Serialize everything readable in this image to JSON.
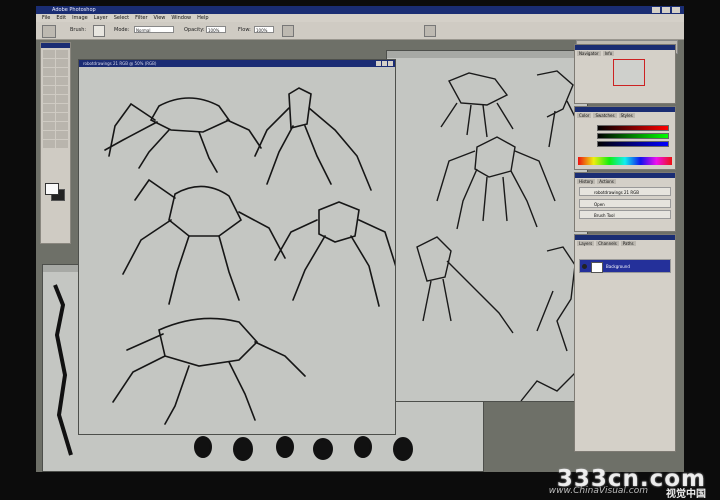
{
  "app": {
    "title": "Adobe Photoshop",
    "menu": [
      "File",
      "Edit",
      "Image",
      "Layer",
      "Select",
      "Filter",
      "View",
      "Window",
      "Help"
    ]
  },
  "options_bar": {
    "brush_label": "Brush:",
    "mode_label": "Mode:",
    "mode_value": "Normal",
    "opacity_label": "Opacity:",
    "opacity_value": "100%",
    "flow_label": "Flow:",
    "flow_value": "100%"
  },
  "documents": {
    "active_title": "robotdrawings 21 RGB @ 50% (RGB)",
    "back_title_1": "",
    "back_title_2": ""
  },
  "palettes": {
    "navigator_tabs": [
      "Navigator",
      "Info"
    ],
    "color_tabs": [
      "Color",
      "Swatches",
      "Styles"
    ],
    "history_tabs": [
      "History",
      "Actions"
    ],
    "history_items": [
      "robotdrawings 21 RGB",
      "Open",
      "Brush Tool"
    ],
    "layers_tabs": [
      "Layers",
      "Channels",
      "Paths"
    ],
    "layer_name": "Background"
  },
  "overlay": {
    "watermark": "333cn.com",
    "site": "www.ChinaVisual.com",
    "brand": "视觉中国"
  },
  "colors": {
    "title_bar": "#1a2d73",
    "workspace": "#6e7068",
    "canvas": "#c4c6c2",
    "layer_selected": "#24309a"
  }
}
